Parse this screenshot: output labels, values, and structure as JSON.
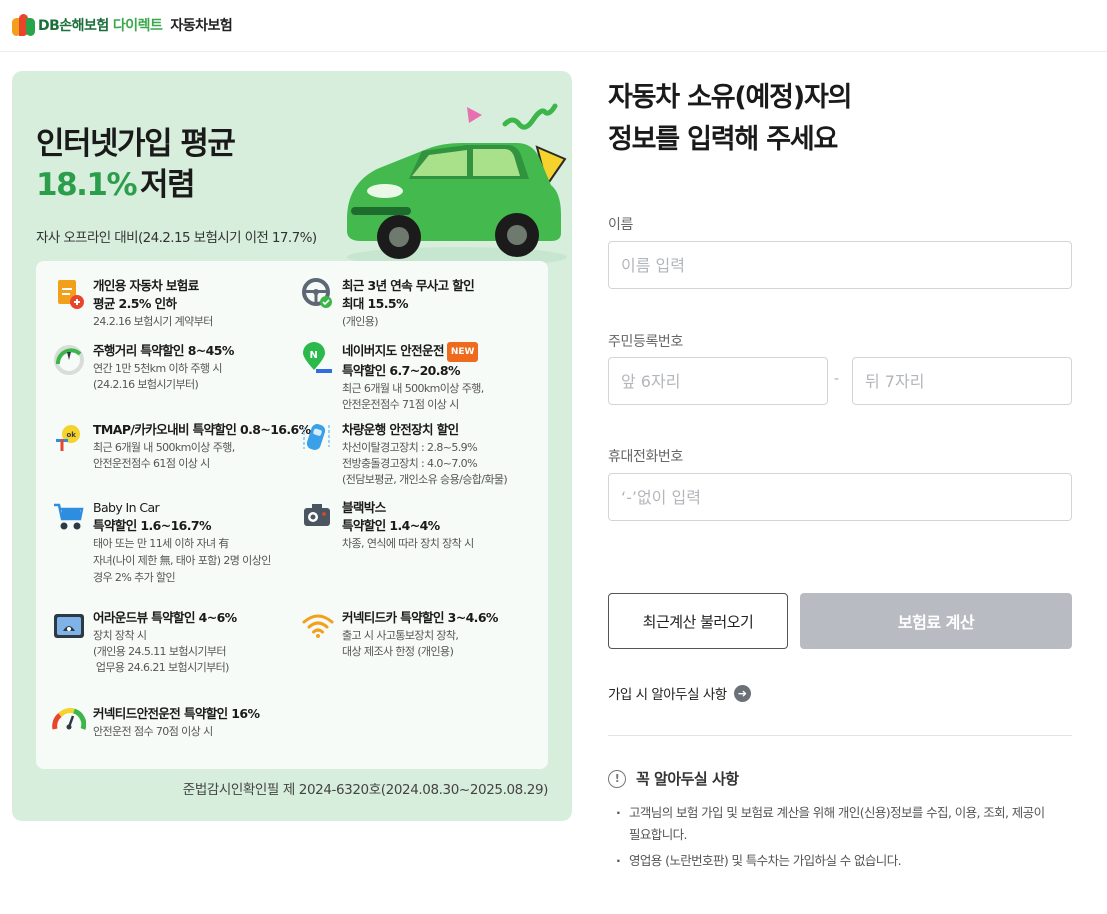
{
  "header": {
    "brand": "DB손해보험",
    "direct": "다이렉트",
    "product": "자동차보험"
  },
  "promo": {
    "headline_1": "인터넷가입 평균",
    "headline_pct": "18.1%",
    "headline_low": "저렴",
    "subtitle": "자사 오프라인 대비(24.2.15 보험시기 이전 17.7%)",
    "benefits": [
      {
        "icon": "document-icon",
        "title_1": "개인용 자동차 보험료",
        "title_2": "평균 2.5% 인하",
        "desc": [
          "24.2.16 보험시기 계약부터"
        ]
      },
      {
        "icon": "steering-wheel-icon",
        "title_1": "최근 3년 연속 무사고 할인",
        "title_2": "최대 15.5%",
        "desc": [
          "(개인용)"
        ]
      },
      {
        "icon": "speedometer-icon",
        "title_1": "주행거리 특약할인 8~45%",
        "title_2": "",
        "desc": [
          "연간 1만 5천km 이하 주행 시",
          "(24.2.16 보험시기부터)"
        ]
      },
      {
        "icon": "naver-map-icon",
        "title_1": "네이버지도 안전운전",
        "badge": "NEW",
        "title_2": "특약할인 6.7~20.8%",
        "desc": [
          "최근 6개월 내 500km이상 주행,",
          "안전운전점수 71점 이상 시"
        ]
      },
      {
        "icon": "tmap-kakao-icon",
        "title_1": "TMAP/카카오내비 특약할인 0.8~16.6%",
        "title_2": "",
        "desc": [
          "최근 6개월 내 500km이상 주행,",
          "안전운전점수 61점 이상 시"
        ]
      },
      {
        "icon": "safety-car-icon",
        "title_1": "차량운행 안전장치 할인",
        "title_2": "",
        "desc": [
          "차선이탈경고장치 : 2.8~5.9%",
          "전방충돌경고장치 : 4.0~7.0%",
          "(전담보평균, 개인소유 승용/승합/화물)"
        ]
      },
      {
        "icon": "baby-stroller-icon",
        "title_1": "Baby In Car",
        "title_2": "특약할인 1.6~16.7%",
        "desc": [
          "태아 또는 만 11세 이하 자녀 有",
          "자녀(나이 제한 無, 태아 포함) 2명 이상인",
          "경우 2% 추가 할인"
        ]
      },
      {
        "icon": "blackbox-icon",
        "title_1": "블랙박스",
        "title_2": "특약할인 1.4~4%",
        "desc": [
          "차종, 연식에 따라 장치 장착 시"
        ]
      },
      {
        "icon": "around-view-icon",
        "title_1": "어라운드뷰 특약할인 4~6%",
        "title_2": "",
        "desc": [
          "장치 장착 시",
          "(개인용 24.5.11 보험시기부터",
          " 업무용 24.6.21 보험시기부터)"
        ]
      },
      {
        "icon": "wifi-icon",
        "title_1": "커넥티드카 특약할인 3~4.6%",
        "title_2": "",
        "desc": [
          "출고 시 사고통보장치 장착,",
          "대상 제조사 한정 (개인용)"
        ]
      },
      {
        "icon": "gauge-icon",
        "title_1": "커넥티드안전운전 특약할인 16%",
        "title_2": "",
        "desc": [
          "안전운전 점수 70점 이상 시"
        ]
      }
    ],
    "footnote": "준법감시인확인필 제 2024-6320호(2024.08.30~2025.08.29)"
  },
  "form": {
    "title_line1": "자동차 소유(예정)자의",
    "title_line2": "정보를 입력해 주세요",
    "name_label": "이름",
    "name_placeholder": "이름 입력",
    "rrn_label": "주민등록번호",
    "rrn_front_placeholder": "앞 6자리",
    "rrn_dash": "-",
    "rrn_back_placeholder": "뒤 7자리",
    "phone_label": "휴대전화번호",
    "phone_placeholder": "‘-’없이 입력",
    "load_button": "최근계산 불러오기",
    "calc_button": "보험료 계산",
    "notice_link": "가입 시 알아두실 사항",
    "must_title": "꼭 알아두실 사항",
    "must_items": [
      "고객님의 보험 가입 및 보험료 계산을 위해 개인(신용)정보를 수집, 이용, 조회, 제공이 필요합니다.",
      "영업용 (노란번호판) 및 특수차는 가입하실 수 없습니다."
    ]
  },
  "colors": {
    "brand_green": "#2a9e4a",
    "promo_bg": "#d8eedd",
    "disabled_button": "#b8bcc2",
    "new_badge": "#ee6a1c"
  }
}
